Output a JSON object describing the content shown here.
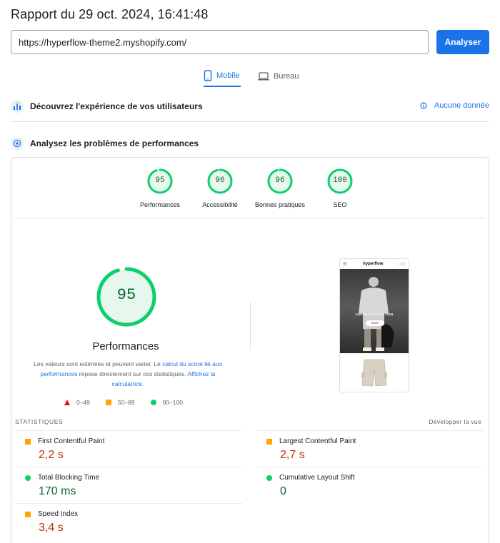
{
  "report": {
    "title": "Rapport du 29 oct. 2024, 16:41:48"
  },
  "search": {
    "url": "https://hyperflow-theme2.myshopify.com/",
    "button_label": "Analyser"
  },
  "device_tabs": [
    {
      "label": "Mobile",
      "active": true,
      "icon": "smartphone-icon"
    },
    {
      "label": "Bureau",
      "active": false,
      "icon": "laptop-icon"
    }
  ],
  "sections": {
    "field": {
      "title": "Découvrez l'expérience de vos utilisateurs",
      "no_data": "Aucune donnée"
    },
    "lab": {
      "title": "Analysez les problèmes de performances"
    }
  },
  "scores": [
    {
      "label": "Performances",
      "value": 95
    },
    {
      "label": "Accessibilité",
      "value": 96
    },
    {
      "label": "Bonnes pratiques",
      "value": 96
    },
    {
      "label": "SEO",
      "value": 100
    }
  ],
  "main_score": {
    "value": 95,
    "label": "Performances"
  },
  "description": {
    "p1": "Les valeurs sont estimées et peuvent varier. Le ",
    "link1": "calcul du score lié aux performances",
    "p2": " repose directement sur ces statistiques. ",
    "link2": "Affichez la calculatrice",
    "p3": "."
  },
  "legend": [
    {
      "shape": "triangle",
      "range": "0–49",
      "color": "#eb0f00"
    },
    {
      "shape": "square",
      "range": "50–89",
      "color": "#ffa400"
    },
    {
      "shape": "circle",
      "range": "90–100",
      "color": "#0cce6b"
    }
  ],
  "screenshot": {
    "logo": "hyperflow",
    "hero_text": "SUPRNA COLLECTION",
    "cta": "SHOP"
  },
  "stats": {
    "title": "STATISTIQUES",
    "expand": "Développer la vue",
    "metrics": [
      {
        "name": "First Contentful Paint",
        "value": "2,2 s",
        "status": "average"
      },
      {
        "name": "Largest Contentful Paint",
        "value": "2,7 s",
        "status": "average"
      },
      {
        "name": "Total Blocking Time",
        "value": "170 ms",
        "status": "good"
      },
      {
        "name": "Cumulative Layout Shift",
        "value": "0",
        "status": "good"
      },
      {
        "name": "Speed Index",
        "value": "3,4 s",
        "status": "average"
      }
    ]
  },
  "colors": {
    "accent": "#1a73e8",
    "good": "#0cce6b",
    "good_text": "#0d652d",
    "average": "#ffa400",
    "average_text": "#c33300",
    "poor": "#eb0f00"
  }
}
